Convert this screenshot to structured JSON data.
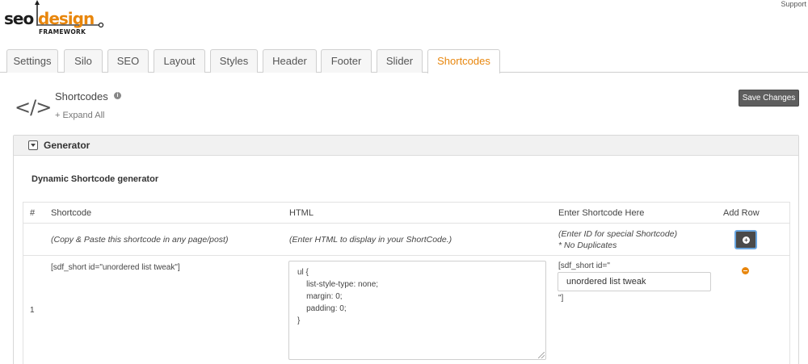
{
  "brand": {
    "seo": "seo",
    "design": "design",
    "framework": "FRAMEWORK",
    "accent": "#e8860c"
  },
  "header": {
    "support": "Support"
  },
  "tabs": [
    {
      "label": "Settings"
    },
    {
      "label": "Silo"
    },
    {
      "label": "SEO"
    },
    {
      "label": "Layout"
    },
    {
      "label": "Styles"
    },
    {
      "label": "Header"
    },
    {
      "label": "Footer"
    },
    {
      "label": "Slider"
    },
    {
      "label": "Shortcodes",
      "active": true
    }
  ],
  "page": {
    "icon": "</>",
    "title": "Shortcodes",
    "info_icon": "i",
    "expand_all": "+ Expand All",
    "save_button": "Save Changes"
  },
  "panel": {
    "title": "Generator",
    "subtitle": "Dynamic Shortcode generator",
    "table": {
      "columns": [
        "#",
        "Shortcode",
        "HTML",
        "Enter Shortcode Here",
        "Add Row"
      ],
      "hints": {
        "shortcode": "(Copy & Paste this shortcode in any page/post)",
        "html": "(Enter HTML to display in your ShortCode.)",
        "id_line1": "(Enter ID for special Shortcode)",
        "id_line2": "* No Duplicates"
      },
      "rows": [
        {
          "number": "1",
          "shortcode": "[sdf_short id=\"unordered list tweak\"]",
          "html": "ul {\n    list-style-type: none;\n    margin: 0;\n    padding: 0;\n}",
          "id_prefix": "[sdf_short id=\"",
          "id_value": "unordered list tweak",
          "id_suffix": "\"]"
        }
      ]
    }
  }
}
